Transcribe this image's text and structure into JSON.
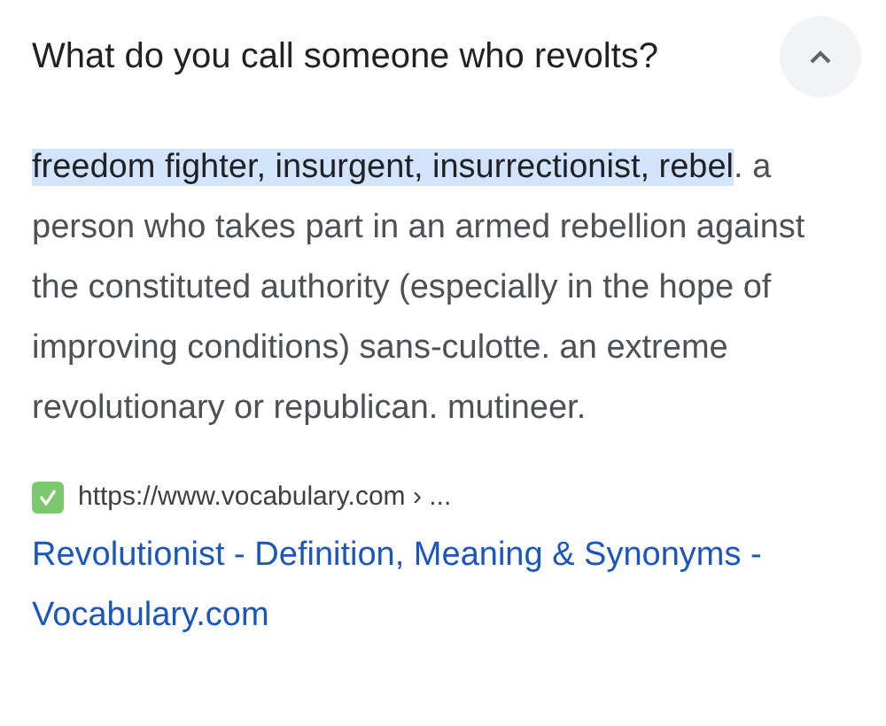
{
  "question": {
    "title": "What do you call someone who revolts?",
    "expanded": true
  },
  "answer": {
    "highlight": "freedom fighter, insurgent, insurrectionist, rebel",
    "text": ". a person who takes part in an armed rebellion against the constituted authority (especially in the hope of improving conditions) sans-culotte. an extreme revolutionary or republican. mutineer."
  },
  "source": {
    "url": "https://www.vocabulary.com › ...",
    "title": "Revolutionist - Definition, Meaning & Synonyms - Vocabulary.com"
  }
}
